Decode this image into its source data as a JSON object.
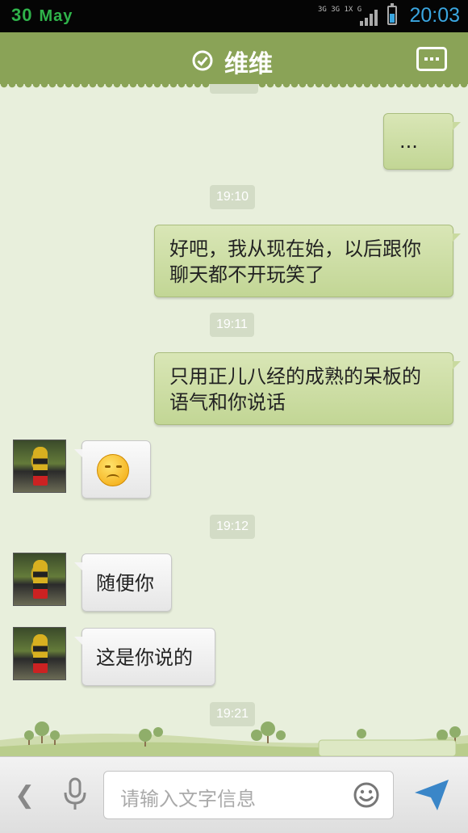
{
  "status_bar": {
    "date_day": "30",
    "date_month": "May",
    "network": "3G 3G 1X G",
    "time": "20:03",
    "battery_level": 0.55
  },
  "header": {
    "contact_name": "维维",
    "verified_icon": "check-circle-icon",
    "menu_icon": "more-dots-icon"
  },
  "messages": [
    {
      "type": "outgoing",
      "text": "..."
    },
    {
      "type": "timestamp",
      "text": "19:10"
    },
    {
      "type": "outgoing",
      "text": "好吧，我从现在始，以后跟你聊天都不开玩笑了"
    },
    {
      "type": "timestamp",
      "text": "19:11"
    },
    {
      "type": "outgoing",
      "text": "只用正儿八经的成熟的呆板的语气和你说话"
    },
    {
      "type": "incoming",
      "text": "",
      "emoji": "sad-face-emoji"
    },
    {
      "type": "timestamp",
      "text": "19:12"
    },
    {
      "type": "incoming",
      "text": "随便你"
    },
    {
      "type": "incoming",
      "text": "这是你说的"
    },
    {
      "type": "timestamp",
      "text": "19:21"
    }
  ],
  "input_bar": {
    "placeholder": "请输入文字信息",
    "back_icon": "chevron-left-icon",
    "voice_icon": "microphone-icon",
    "emoji_icon": "smiley-icon",
    "send_icon": "send-arrow-icon"
  },
  "colors": {
    "header": "#8aa357",
    "outgoing_bubble": "#c9da9f",
    "incoming_bubble": "#f4f4f4",
    "background": "#e8efdc",
    "time_accent": "#3aa6e0"
  }
}
